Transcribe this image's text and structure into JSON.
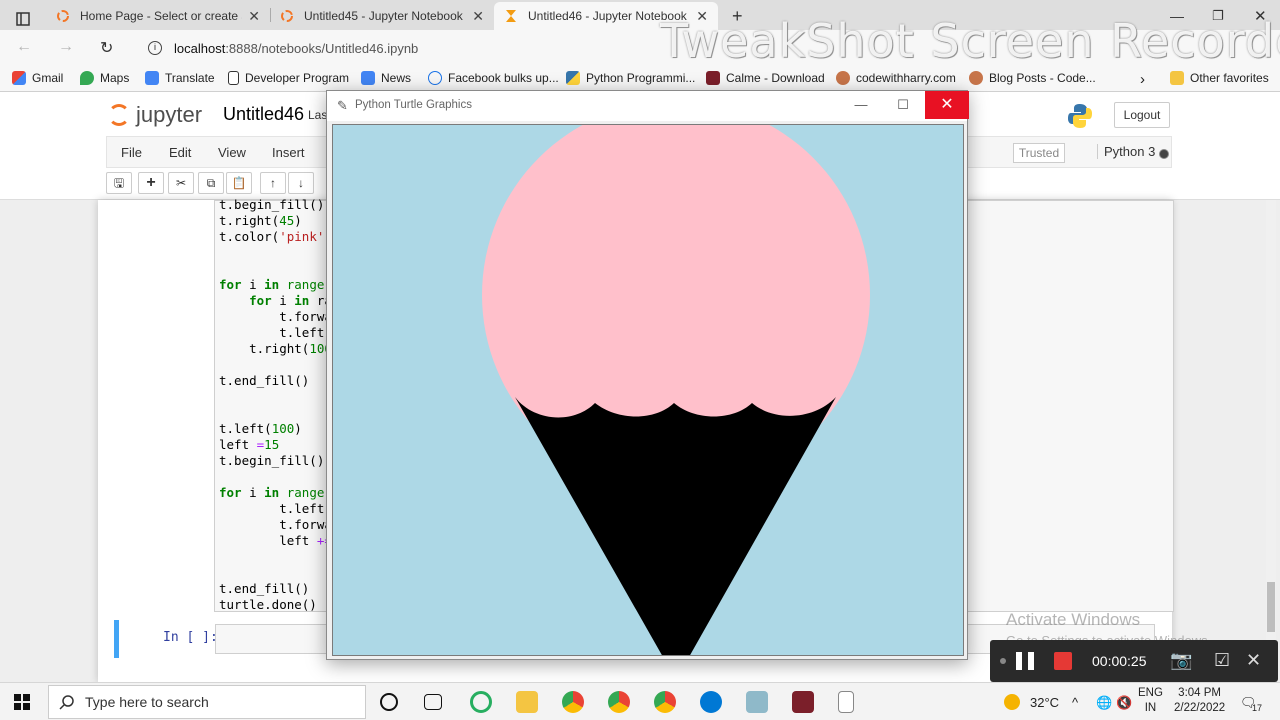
{
  "browser": {
    "tabs": [
      {
        "title": "Home Page - Select or create a n",
        "icon": "jupyter-icon",
        "active": false
      },
      {
        "title": "Untitled45 - Jupyter Notebook",
        "icon": "jupyter-icon",
        "active": false
      },
      {
        "title": "Untitled46 - Jupyter Notebook",
        "icon": "hourglass-icon",
        "active": true
      }
    ],
    "new_tab": "+",
    "url_host": "localhost",
    "url_path": ":8888/notebooks/Untitled46.ipynb",
    "bookmarks": [
      {
        "label": "Gmail",
        "icon": "gmail-icon"
      },
      {
        "label": "Maps",
        "icon": "maps-icon"
      },
      {
        "label": "Translate",
        "icon": "translate-icon"
      },
      {
        "label": "Developer Program",
        "icon": "page-icon"
      },
      {
        "label": "News",
        "icon": "news-icon"
      },
      {
        "label": "Facebook bulks up...",
        "icon": "globe-icon"
      },
      {
        "label": "Python Programmi...",
        "icon": "python-icon"
      },
      {
        "label": "Calme - Download",
        "icon": "calme-icon"
      },
      {
        "label": "codewithharry.com",
        "icon": "avatar-icon"
      },
      {
        "label": "Blog Posts - Code...",
        "icon": "avatar-icon"
      }
    ],
    "other_favorites": "Other favorites"
  },
  "watermark": "TweakShot Screen Recorder",
  "jupyter": {
    "logo_text": "jupyter",
    "notebook_name": "Untitled46",
    "last_checkpoint": "Las",
    "logout": "Logout",
    "menus": [
      "File",
      "Edit",
      "View",
      "Insert"
    ],
    "trusted": "Trusted",
    "kernel": "Python 3"
  },
  "code": {
    "l1": "t.begin_fill()",
    "l2a": "t.right(",
    "l2b": "45",
    "l2c": ")",
    "l3a": "t.color(",
    "l3b": "'pink'",
    "l3c": ")",
    "l4a": "for",
    "l4b": " i ",
    "l4c": "in",
    "l4d": " range(",
    "l5a": "    for",
    "l5b": " i ",
    "l5c": "in",
    "l5d": " ra",
    "l6": "        t.forwa",
    "l7": "        t.left(",
    "l8a": "    t.right(",
    "l8b": "100",
    "l9": "t.end_fill()",
    "l10a": "t.left(",
    "l10b": "100",
    "l10c": ")",
    "l11a": "left ",
    "l11b": "=",
    "l11c": "15",
    "l12": "t.begin_fill()",
    "l13a": "for",
    "l13b": " i ",
    "l13c": "in",
    "l13d": " range(",
    "l14": "        t.left(",
    "l15": "        t.forwa",
    "l16a": "        left ",
    "l16b": "+=",
    "l17": "t.end_fill()",
    "l18": "turtle.done()"
  },
  "empty_cell_prompt": "In [ ]:",
  "turtle_window": {
    "title": "Python Turtle Graphics",
    "minimize": "—",
    "maximize": "☐",
    "close": "✕",
    "background_color": "#add8e6",
    "scoop_color": "#ffc0cb",
    "cone_color": "#000000"
  },
  "windows_activation": {
    "line1": "Activate Windows",
    "line2": "Go to Settings to activate Windows."
  },
  "recorder": {
    "time": "00:00:25"
  },
  "taskbar": {
    "search_placeholder": "Type here to search",
    "temperature": "32°C",
    "language": "ENG",
    "region": "IN",
    "time": "3:04 PM",
    "date": "2/22/2022",
    "notifications": "17"
  }
}
